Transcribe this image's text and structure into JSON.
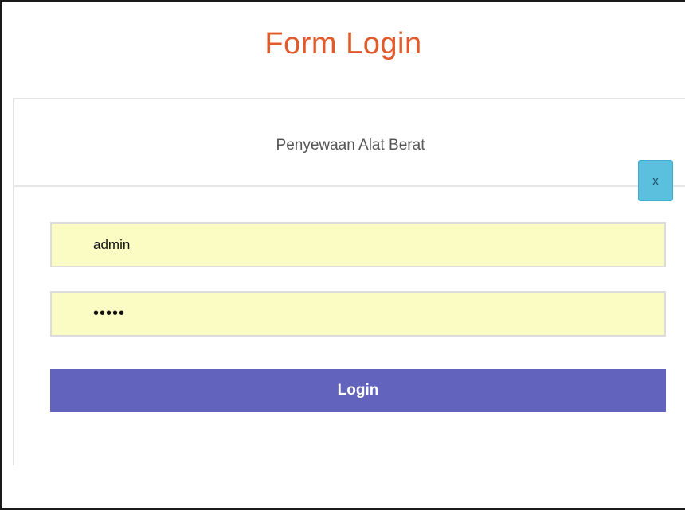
{
  "page": {
    "title": "Form Login",
    "title_color": "#e05a2b"
  },
  "panel": {
    "subtitle": "Penyewaan Alat Berat"
  },
  "close_button": {
    "label": "x",
    "color": "#5bc0de"
  },
  "form": {
    "username_value": "admin",
    "password_value": "•••••",
    "field_background": "#fafcc4",
    "login_label": "Login",
    "login_color": "#6163bd"
  }
}
